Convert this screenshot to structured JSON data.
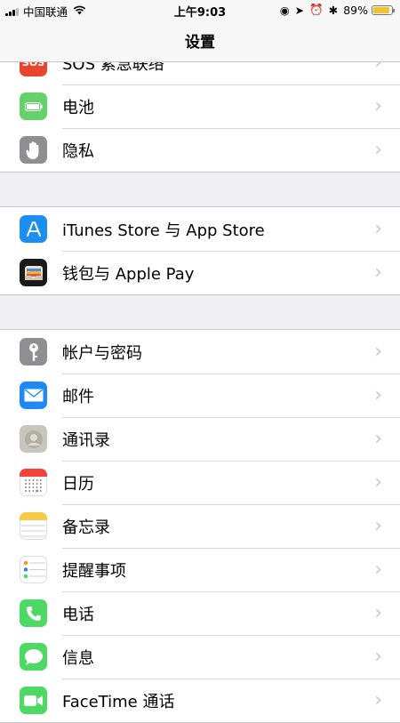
{
  "status_bar": {
    "carrier": "中国联通",
    "time": "上午9:03",
    "battery_percent": "89%",
    "battery_level": 0.89
  },
  "nav": {
    "title": "设置"
  },
  "groups": [
    {
      "items": [
        {
          "label": "SOS 紧急联络",
          "icon": "sos-icon",
          "icon_text": "SOS",
          "color": "#e6462e"
        },
        {
          "label": "电池",
          "icon": "battery-icon",
          "color": "#64d26a"
        },
        {
          "label": "隐私",
          "icon": "hand-icon",
          "color": "#8e8e93"
        }
      ]
    },
    {
      "items": [
        {
          "label": "iTunes Store 与 App Store",
          "icon": "app-store-icon",
          "color": "#1c8ef2"
        },
        {
          "label": "钱包与 Apple Pay",
          "icon": "wallet-icon",
          "color": "#1a1a1a"
        }
      ]
    },
    {
      "items": [
        {
          "label": "帐户与密码",
          "icon": "key-icon",
          "color": "#8e8e93"
        },
        {
          "label": "邮件",
          "icon": "mail-icon",
          "color": "#1e88f5"
        },
        {
          "label": "通讯录",
          "icon": "contacts-icon",
          "color": "#c8c5bd"
        },
        {
          "label": "日历",
          "icon": "calendar-icon",
          "color": "#ffffff"
        },
        {
          "label": "备忘录",
          "icon": "notes-icon",
          "color": "#ffffff"
        },
        {
          "label": "提醒事项",
          "icon": "reminders-icon",
          "color": "#ffffff"
        },
        {
          "label": "电话",
          "icon": "phone-icon",
          "color": "#4cd964"
        },
        {
          "label": "信息",
          "icon": "messages-icon",
          "color": "#4cd964"
        },
        {
          "label": "FaceTime 通话",
          "icon": "facetime-icon",
          "color": "#4cd964"
        }
      ]
    }
  ]
}
